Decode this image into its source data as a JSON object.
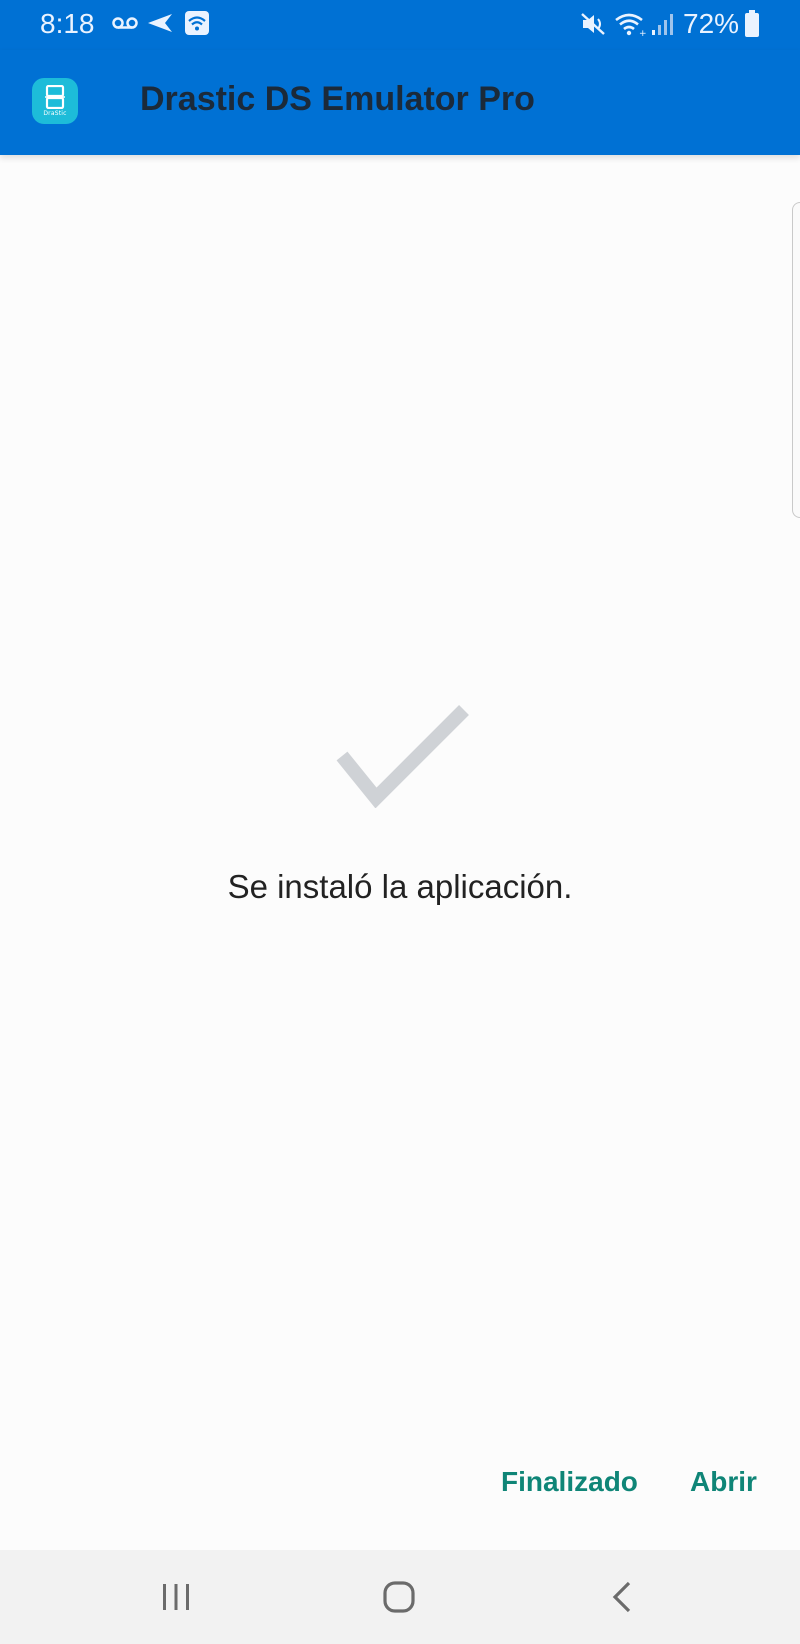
{
  "status_bar": {
    "time": "8:18",
    "battery": "72%",
    "icons": [
      "voicemail-icon",
      "send-icon",
      "wifi-calling-icon",
      "mute-icon",
      "wifi-icon",
      "signal-icon",
      "battery-icon"
    ]
  },
  "app_bar": {
    "icon_label": "DraStic",
    "title": "Drastic DS Emulator Pro"
  },
  "content": {
    "message": "Se instaló la aplicación."
  },
  "actions": {
    "done_label": "Finalizado",
    "open_label": "Abrir"
  },
  "colors": {
    "primary": "#0071d4",
    "accent": "#0f8577",
    "check": "#cfd2d6"
  }
}
